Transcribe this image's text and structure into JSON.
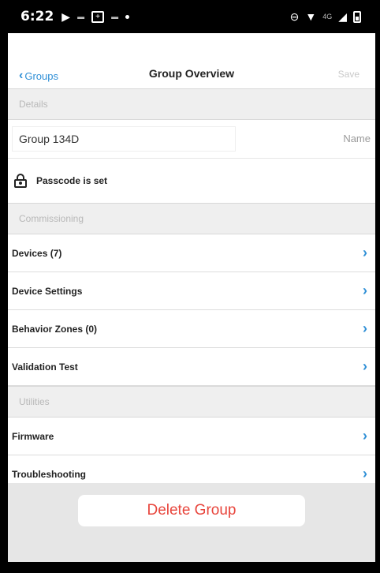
{
  "status_bar": {
    "time": "6:22",
    "network": "4G"
  },
  "nav": {
    "back_label": "Groups",
    "title": "Group Overview",
    "save_label": "Save"
  },
  "details": {
    "header": "Details",
    "group_name_value": "Group 134D",
    "name_label": "Name",
    "passcode_text": "Passcode is set"
  },
  "commissioning": {
    "header": "Commissioning",
    "items": [
      {
        "label": "Devices (7)"
      },
      {
        "label": "Device Settings"
      },
      {
        "label": "Behavior Zones (0)"
      },
      {
        "label": "Validation Test"
      }
    ]
  },
  "utilities": {
    "header": "Utilities",
    "items": [
      {
        "label": "Firmware"
      },
      {
        "label": "Troubleshooting"
      }
    ]
  },
  "delete_button_label": "Delete Group",
  "colors": {
    "accent": "#2f8fd6",
    "danger": "#e8453c"
  }
}
